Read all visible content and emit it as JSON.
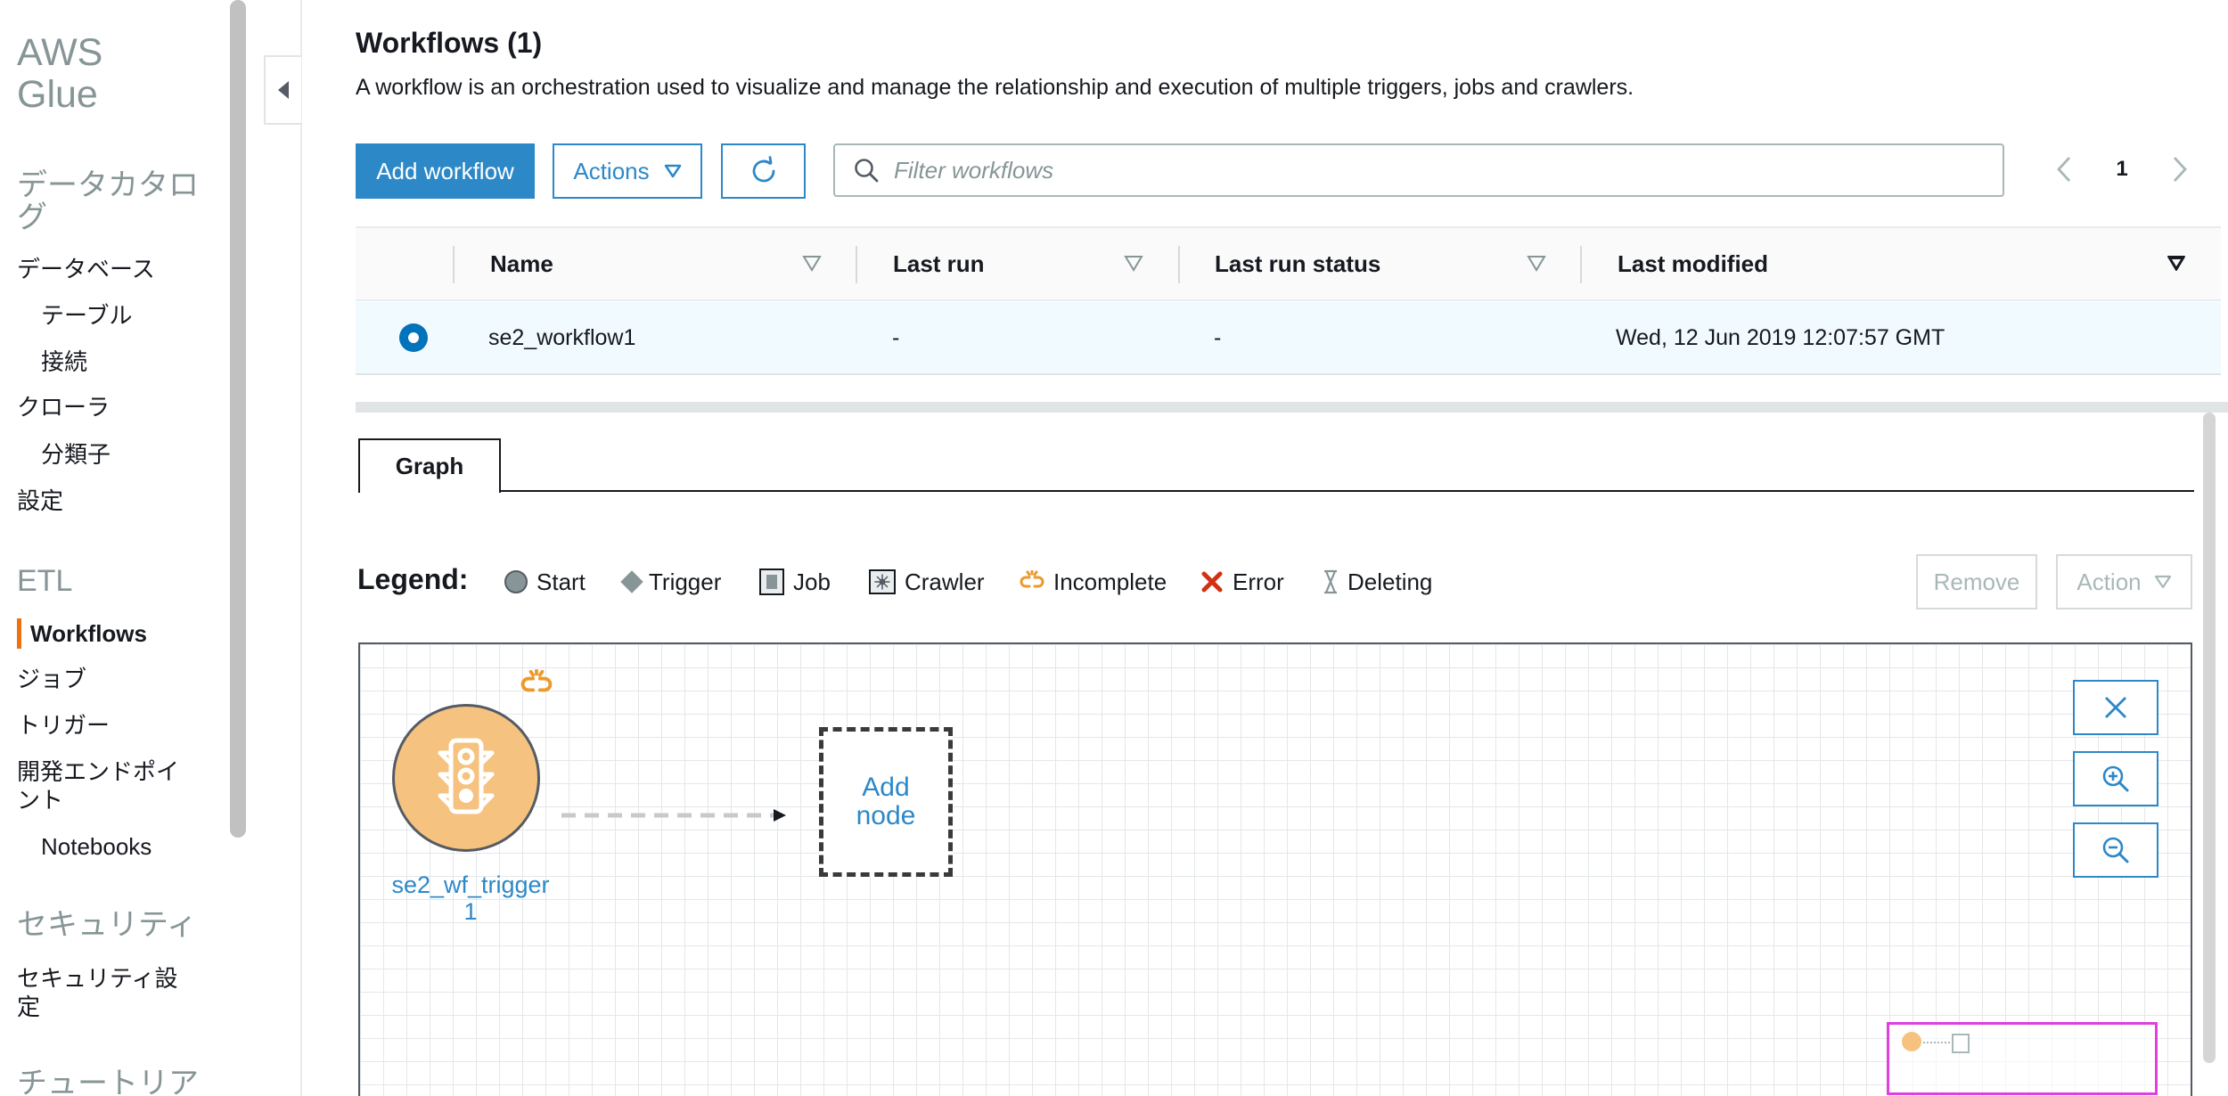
{
  "sidebar": {
    "brand_line1": "AWS",
    "brand_line2": "Glue",
    "sections": {
      "data_catalog": "データカタログ",
      "etl": "ETL",
      "security": "セキュリティ",
      "tutorial": "チュートリア"
    },
    "items": {
      "databases": "データベース",
      "tables": "テーブル",
      "connections": "接続",
      "crawlers": "クローラ",
      "classifiers": "分類子",
      "settings": "設定",
      "workflows": "Workflows",
      "jobs": "ジョブ",
      "triggers": "トリガー",
      "dev_endpoints": "開発エンドポイント",
      "notebooks": "Notebooks",
      "security_config": "セキュリティ設定"
    },
    "accent_color": "#ec7211"
  },
  "header": {
    "title": "Workflows (1)",
    "description": "A workflow is an orchestration used to visualize and manage the relationship and execution of multiple triggers, jobs and crawlers."
  },
  "toolbar": {
    "add_label": "Add workflow",
    "actions_label": "Actions",
    "refresh_icon": "refresh-icon",
    "search_placeholder": "Filter workflows",
    "page": "1",
    "primary_color": "#2d88c8"
  },
  "table": {
    "columns": [
      "Name",
      "Last run",
      "Last run status",
      "Last modified"
    ],
    "rows": [
      {
        "selected": true,
        "name": "se2_workflow1",
        "last_run": "-",
        "last_run_status": "-",
        "last_modified": "Wed, 12 Jun 2019 12:07:57 GMT"
      }
    ]
  },
  "detail": {
    "tab": "Graph",
    "legend_title": "Legend:",
    "legend": [
      {
        "label": "Start",
        "icon": "start-circle-icon"
      },
      {
        "label": "Trigger",
        "icon": "trigger-diamond-icon"
      },
      {
        "label": "Job",
        "icon": "job-icon"
      },
      {
        "label": "Crawler",
        "icon": "crawler-icon"
      },
      {
        "label": "Incomplete",
        "icon": "broken-link-icon"
      },
      {
        "label": "Error",
        "icon": "error-x-icon"
      },
      {
        "label": "Deleting",
        "icon": "hourglass-icon"
      }
    ],
    "remove_label": "Remove",
    "action_label": "Action",
    "graph": {
      "trigger_node_label": "se2_wf_trigger1",
      "trigger_node_label_line1": "se2_wf_trigger",
      "trigger_node_label_line2": "1",
      "add_node_line1": "Add",
      "add_node_line2": "node",
      "node_color": "#f6c27f"
    }
  }
}
